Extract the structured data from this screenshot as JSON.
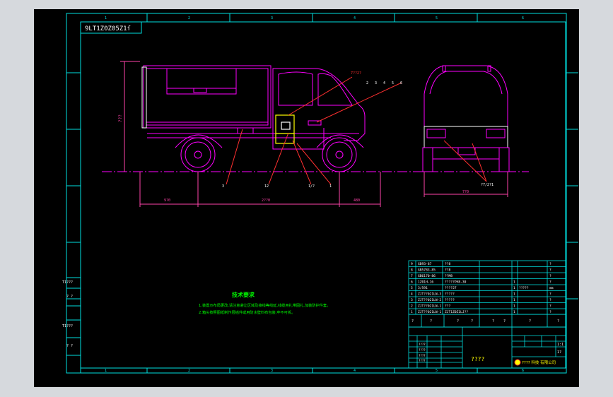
{
  "drawing": {
    "code_rotated": "9LT1Z0Z05Z1ſ",
    "zone_numbers_top": [
      "1",
      "2",
      "3",
      "4",
      "5",
      "6"
    ],
    "zone_numbers_bottom": [
      "1",
      "2",
      "3",
      "4",
      "5",
      "6"
    ],
    "left_side_labels": [
      "T1???",
      "? ?",
      "T1???",
      "? ?"
    ],
    "side_view_height_label": "???",
    "dims": {
      "front_overhang": "9?0",
      "wheelbase": "2??0",
      "rear_overhang": "480",
      "track_width": "7?0"
    },
    "callouts_side": [
      "3",
      "12",
      "1/?",
      "1"
    ],
    "callouts_top_left": "7??2?",
    "callouts_top_right": [
      "2",
      "3",
      "4",
      "5",
      "6"
    ],
    "callout_rear": "?7/2?1"
  },
  "tech_requirements": {
    "title": "技术要求",
    "lines": [
      "1.装置示布局更改,请注意避让区域及接线等线延,线缆用扎带固扎,加装防护件套。",
      "2.箱头按照图纸制作层插件或用防水壁料布包装,牢不可拆。"
    ]
  },
  "parts_list": {
    "rows": [
      {
        "no": "9",
        "code": "GB93-87",
        "name": "??8",
        "qty": "",
        "note": "?"
      },
      {
        "no": "8",
        "code": "GB5783-85",
        "name": "??8",
        "qty": "",
        "note": "?"
      },
      {
        "no": "7",
        "code": "GB6170-86",
        "name": "??M8",
        "qty": "",
        "note": "?"
      },
      {
        "no": "6",
        "code": "1Z01H-16",
        "name": "?????PH8-30",
        "qty": "1",
        "note": "?"
      },
      {
        "no": "5",
        "code": "3/591",
        "name": "????27",
        "qty": "1",
        "note": "mm"
      },
      {
        "no": "4",
        "code": "ZJT??021LN-3",
        "name": "?????",
        "qty": "1",
        "note": "?"
      },
      {
        "no": "3",
        "code": "ZJT??021LN-2",
        "name": "?????",
        "qty": "1",
        "note": "?"
      },
      {
        "no": "2",
        "code": "ZJT??021LN-1",
        "name": "???",
        "qty": "1",
        "note": "?"
      },
      {
        "no": "1",
        "code": "ZJT??021LN-1",
        "name": "ZJT1Z0Z1LJ??",
        "qty": "1",
        "note": "?"
      }
    ],
    "extra_tag": "?????",
    "header": [
      "?",
      "?",
      "?",
      "?",
      "?",
      "?",
      "?",
      "?"
    ]
  },
  "title_block": {
    "drawing_title": "????",
    "company": "???? 科技 有限公司",
    "scale": "1:1",
    "sheet": "1?",
    "sign_rows": [
      "????",
      "????",
      "????",
      "????"
    ]
  },
  "colors": {
    "border": "#00e0e0",
    "truck": "#ff00ff",
    "highlight": "#ffff00",
    "dimension": "#ff44aa",
    "text_green": "#00ff00",
    "leader": "#ff3030",
    "text_white": "#ffffff"
  }
}
